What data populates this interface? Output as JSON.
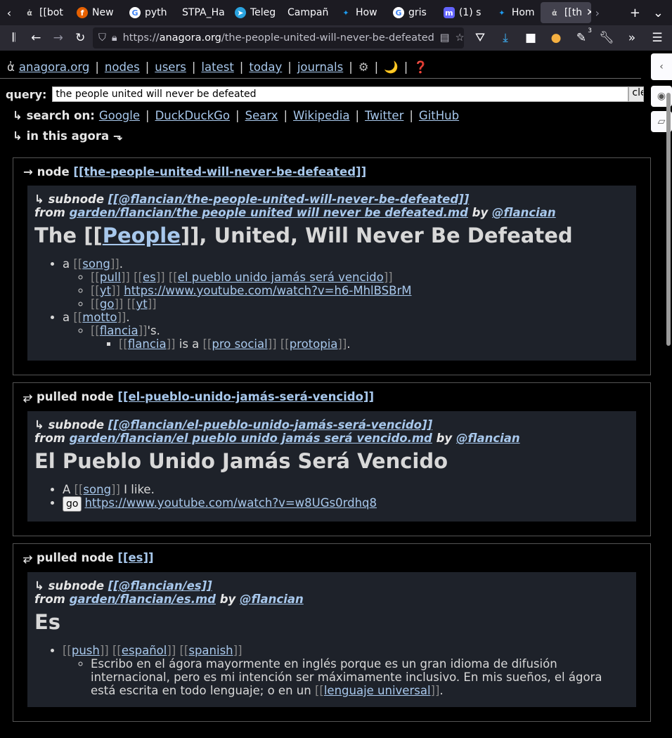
{
  "tabs": [
    {
      "label": "[[bot",
      "icon": "agora-icon"
    },
    {
      "label": "New",
      "icon": "firefox-icon"
    },
    {
      "label": "pyth",
      "icon": "google-icon"
    },
    {
      "label": "STPA_Ha",
      "icon": ""
    },
    {
      "label": "Teleg",
      "icon": "telegram-icon"
    },
    {
      "label": "Campañ",
      "icon": ""
    },
    {
      "label": "How",
      "icon": "twitter-icon"
    },
    {
      "label": "gris",
      "icon": "google-icon"
    },
    {
      "label": "(1) s",
      "icon": "mastodon-icon"
    },
    {
      "label": "Hom",
      "icon": "twitter-icon"
    },
    {
      "label": "[[th",
      "icon": "agora-icon",
      "active": true
    }
  ],
  "url": {
    "prefix": "https://",
    "host": "anagora.org",
    "path": "/the-people-united-will-never-be-defeated"
  },
  "badge_count": "3",
  "topnav": {
    "logo": "ἀ",
    "links": [
      "anagora.org",
      "nodes",
      "users",
      "latest",
      "today",
      "journals"
    ],
    "gear": "⚙",
    "moon": "🌙",
    "help": "❓"
  },
  "query": {
    "label": "query:",
    "value": "the people united will never be defeated",
    "clear": "clear"
  },
  "searchon": {
    "label": "↳ search on:",
    "engines": [
      "Google",
      "DuckDuckGo",
      "Searx",
      "Wikipedia",
      "Twitter",
      "GitHub"
    ]
  },
  "inagora": "↳ in this agora ⬎",
  "node1": {
    "prefix": "→ node",
    "title": "[[the-people-united-will-never-be-defeated]]",
    "sub_prefix": "↳ subnode",
    "sub_title": "[[@flancian/the-people-united-will-never-be-defeated]]",
    "from": "from",
    "path": "garden/flancian/the people united will never be defeated.md",
    "by": "by",
    "user": "@flancian",
    "h1_a": "The [[",
    "h1_link": "People",
    "h1_b": "]], United, Will Never Be Defeated",
    "li1_a": "a",
    "li1_link": "song",
    "li1_end": ".",
    "l_pull": "pull",
    "l_es": "es",
    "l_pueblo": "el pueblo unido jamás será vencido",
    "l_yt": "yt",
    "l_url": "https://www.youtube.com/watch?v=h6-MhlBSBrM",
    "l_go": "go",
    "l_yt2": "yt",
    "li2_a": "a",
    "li2_link": "motto",
    "li2_end": ".",
    "l_flancia": "flancia",
    "l_s": "'s.",
    "l_flancia2": "flancia",
    "l_isa": "is a",
    "l_prosocial": "pro social",
    "l_protopia": "protopia",
    "l_end": "."
  },
  "node2": {
    "prefix": "⥂ pulled node",
    "title": "[[el-pueblo-unido-jamás-será-vencido]]",
    "sub_prefix": "↳ subnode",
    "sub_title": "[[@flancian/el-pueblo-unido-jamás-será-vencido]]",
    "from": "from",
    "path": "garden/flancian/el pueblo unido jamás será vencido.md",
    "by": "by",
    "user": "@flancian",
    "h1": "El Pueblo Unido Jamás Será Vencido",
    "li1_a": "A",
    "li1_link": "song",
    "li1_end": "I like.",
    "go": "go",
    "url": "https://www.youtube.com/watch?v=w8UGs0rdhq8"
  },
  "node3": {
    "prefix": "⥂ pulled node",
    "title": "[[es]]",
    "sub_prefix": "↳ subnode",
    "sub_title": "[[@flancian/es]]",
    "from": "from",
    "path": "garden/flancian/es.md",
    "by": "by",
    "user": "@flancian",
    "h1": "Es",
    "l_push": "push",
    "l_espanol": "español",
    "l_spanish": "spanish",
    "text": "Escribo en el ágora mayormente en inglés porque es un gran idioma de difusión internacional, pero es mi intención ser máximamente inclusivo. En mis sueños, el ágora está escrita en todo lenguaje; o en un",
    "l_lenguaje": "lenguaje universal",
    "end": "."
  }
}
